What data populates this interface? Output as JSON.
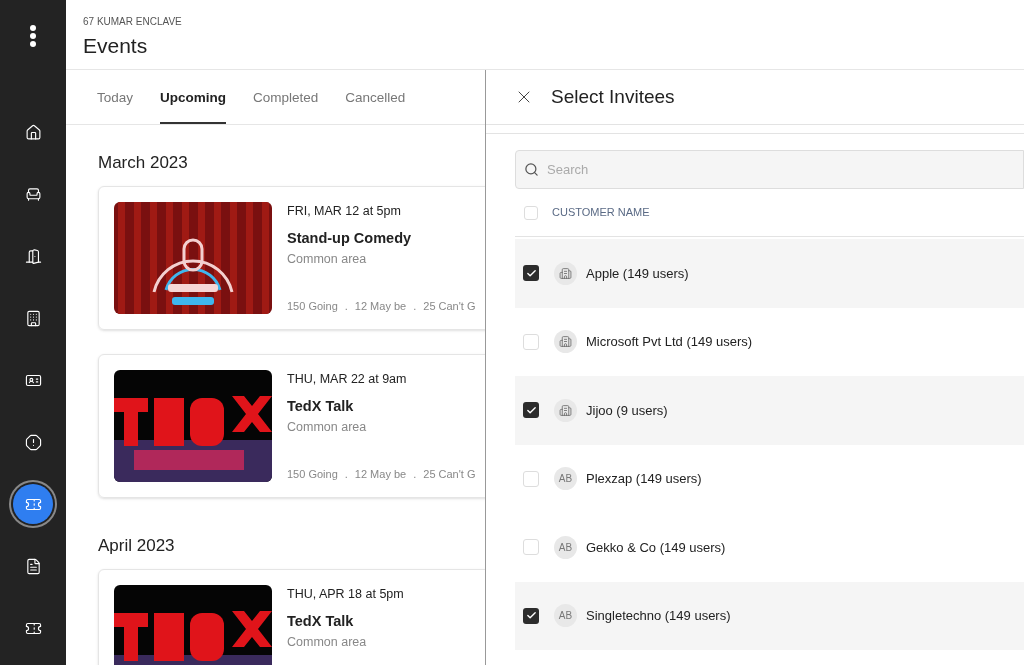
{
  "header": {
    "location": "67 KUMAR ENCLAVE",
    "title": "Events"
  },
  "sidebar": {
    "items": [
      {
        "selected": false
      },
      {
        "selected": false
      },
      {
        "selected": false
      },
      {
        "selected": false
      },
      {
        "selected": false
      },
      {
        "selected": false
      },
      {
        "selected": true
      },
      {
        "selected": false
      },
      {
        "selected": false
      }
    ]
  },
  "tabs": [
    {
      "label": "Today",
      "selected": false
    },
    {
      "label": "Upcoming",
      "selected": true
    },
    {
      "label": "Completed",
      "selected": false
    },
    {
      "label": "Cancelled",
      "selected": false
    }
  ],
  "months": [
    {
      "title": "March 2023",
      "events": [
        {
          "date": "FRI, MAR 12 at 5pm",
          "title": "Stand-up Comedy",
          "place": "Common area",
          "stats": [
            "150 Going",
            ".",
            "12 May be",
            ".",
            "25 Can't G"
          ]
        },
        {
          "date": "THU, MAR 22 at 9am",
          "title": "TedX Talk",
          "place": "Common area",
          "stats": [
            "150 Going",
            ".",
            "12 May be",
            ".",
            "25 Can't G"
          ]
        }
      ]
    },
    {
      "title": "April 2023",
      "events": [
        {
          "date": "THU, APR 18 at 5pm",
          "title": "TedX Talk",
          "place": "Common area"
        }
      ]
    }
  ],
  "drawer": {
    "title": "Select Invitees",
    "search": {
      "placeholder": "Search"
    },
    "column": {
      "label": "CUSTOMER NAME",
      "checked": false
    },
    "rows": [
      {
        "name": "Apple (149 users)",
        "checked": true,
        "kind": "building"
      },
      {
        "name": "Microsoft Pvt Ltd (149 users)",
        "checked": false,
        "kind": "building"
      },
      {
        "name": "Jijoo (9 users)",
        "checked": true,
        "kind": "building"
      },
      {
        "name": "Plexzap (149 users)",
        "checked": false,
        "kind": "initials",
        "initials": "AB"
      },
      {
        "name": "Gekko & Co (149 users)",
        "checked": false,
        "kind": "initials",
        "initials": "AB"
      },
      {
        "name": "Singletechno (149 users)",
        "checked": true,
        "kind": "initials",
        "initials": "AB"
      }
    ]
  }
}
